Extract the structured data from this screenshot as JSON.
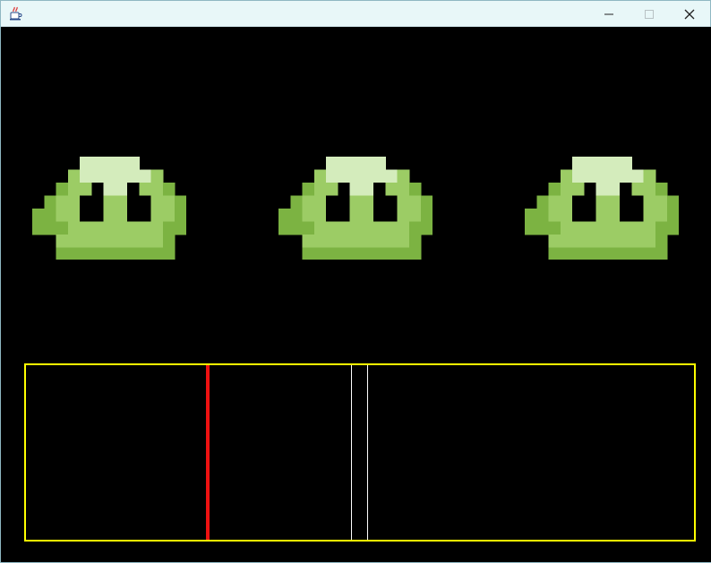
{
  "window": {
    "title": "",
    "icon": "java-cup-icon",
    "controls": {
      "minimize_icon": "minimize-icon",
      "maximize_icon": "maximize-icon",
      "close_icon": "close-icon"
    }
  },
  "game": {
    "background_color": "#000000",
    "enemies": [
      {
        "type": "green-slime"
      },
      {
        "type": "green-slime"
      },
      {
        "type": "green-slime"
      }
    ],
    "slime_colors": {
      "body": "#9ccc65",
      "shade": "#7cb342",
      "highlight": "#d4ecbc"
    },
    "timing_bar": {
      "border_color": "#ffff00",
      "cursor_color": "#ee1111",
      "cursor_position": 0.27,
      "hit_zone_color": "#ffffff",
      "hit_zone_start": 0.487,
      "hit_zone_end": 0.512
    }
  }
}
